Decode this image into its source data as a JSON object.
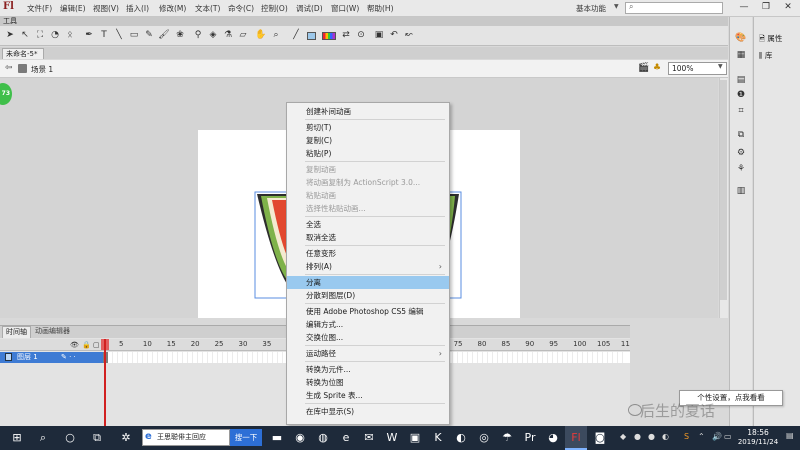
{
  "app": {
    "logo": "Fl"
  },
  "menubar": {
    "items": [
      "文件(F)",
      "编辑(E)",
      "视图(V)",
      "插入(I)",
      "修改(M)",
      "文本(T)",
      "命令(C)",
      "控制(O)",
      "调试(D)",
      "窗口(W)",
      "帮助(H)"
    ],
    "workspace": "基本功能",
    "search_placeholder": ""
  },
  "tools_panel": {
    "label": "工具"
  },
  "document": {
    "tab": "未命名-5*",
    "scene": "场景 1",
    "zoom": "100%"
  },
  "badge": "73",
  "right_panel": {
    "properties": "属性",
    "library": "库"
  },
  "timeline": {
    "tabs": [
      "时间轴",
      "动画编辑器"
    ],
    "ruler": [
      "5",
      "10",
      "15",
      "20",
      "25",
      "30",
      "35",
      "",
      "",
      "",
      "",
      "",
      "",
      "",
      "75",
      "80",
      "85",
      "90",
      "95",
      "100",
      "105",
      "11"
    ],
    "layer_name": "图层 1"
  },
  "context_menu": {
    "items": [
      {
        "label": "创建补间动画",
        "enabled": true
      },
      {
        "sep": true
      },
      {
        "label": "剪切(T)",
        "enabled": true
      },
      {
        "label": "复制(C)",
        "enabled": true
      },
      {
        "label": "粘贴(P)",
        "enabled": true
      },
      {
        "sep": true
      },
      {
        "label": "复制动画",
        "enabled": false
      },
      {
        "label": "将动画复制为 ActionScript 3.0...",
        "enabled": false
      },
      {
        "label": "粘贴动画",
        "enabled": false
      },
      {
        "label": "选择性粘贴动画...",
        "enabled": false
      },
      {
        "sep": true
      },
      {
        "label": "全选",
        "enabled": true
      },
      {
        "label": "取消全选",
        "enabled": true
      },
      {
        "sep": true
      },
      {
        "label": "任意变形",
        "enabled": true
      },
      {
        "label": "排列(A)",
        "enabled": true,
        "submenu": true
      },
      {
        "sep": true
      },
      {
        "label": "分离",
        "enabled": true,
        "highlighted": true
      },
      {
        "label": "分散到图层(D)",
        "enabled": true
      },
      {
        "sep": true
      },
      {
        "label": "使用 Adobe Photoshop CS5 编辑",
        "enabled": true
      },
      {
        "label": "编辑方式...",
        "enabled": true
      },
      {
        "label": "交换位图...",
        "enabled": true
      },
      {
        "sep": true
      },
      {
        "label": "运动路径",
        "enabled": true,
        "submenu": true
      },
      {
        "sep": true
      },
      {
        "label": "转换为元件...",
        "enabled": true
      },
      {
        "label": "转换为位图",
        "enabled": true
      },
      {
        "label": "生成 Sprite 表...",
        "enabled": true
      },
      {
        "sep": true
      },
      {
        "label": "在库中显示(S)",
        "enabled": true
      }
    ]
  },
  "tooltip": "个性设置，点我看看",
  "watermark": "后生的夏话",
  "taskbar": {
    "search_text": "王思聪俳主回应",
    "search_button": "搜一下",
    "time": "18:56",
    "date": "2019/11/24"
  }
}
